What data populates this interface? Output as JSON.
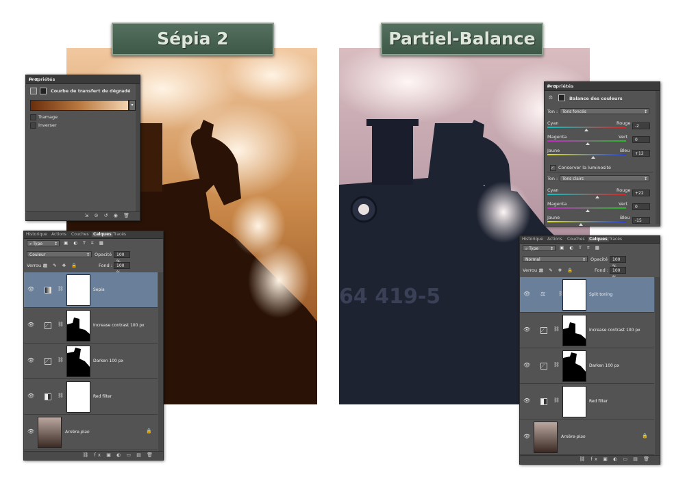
{
  "titles": {
    "left": "Sépia 2",
    "right": "Partiel-Balance"
  },
  "left_properties": {
    "title": "Propriétés",
    "heading": "Courbe de transfert de dégradé",
    "options": [
      "Tramage",
      "Inverser"
    ]
  },
  "left_layers": {
    "tabs": [
      "Historique",
      "Actions",
      "Couches",
      "Calques",
      "Tracés"
    ],
    "filter": "Type",
    "blend_mode": "Couleur",
    "opacity_label": "Opacité :",
    "opacity_value": "100 %",
    "lock_label": "Verrou :",
    "fill_label": "Fond :",
    "fill_value": "100 %",
    "layers": [
      "Sepia",
      "Increase contrast 100 px",
      "Darken 100 px",
      "Red filter",
      "Arrière-plan"
    ]
  },
  "right_properties": {
    "title": "Propriétés",
    "heading": "Balance des couleurs",
    "tone_label": "Ton :",
    "tone1": "Tons foncés",
    "tone2": "Tons clairs",
    "cyan": "Cyan",
    "rouge": "Rouge",
    "magenta": "Magenta",
    "vert": "Vert",
    "jaune": "Jaune",
    "bleu": "Bleu",
    "values1": [
      "-2",
      "0",
      "+12"
    ],
    "values2": [
      "+22",
      "0",
      "-15"
    ],
    "preserve": "Conserver la luminosité"
  },
  "right_layers": {
    "tabs": [
      "Historique",
      "Actions",
      "Couches",
      "Calques",
      "Tracés"
    ],
    "filter": "Type",
    "blend_mode": "Normal",
    "opacity_label": "Opacité :",
    "opacity_value": "100 %",
    "lock_label": "Verrou :",
    "fill_label": "Fond :",
    "fill_value": "100 %",
    "layers": [
      "Split toning",
      "Increase contrast 100 px",
      "Darken 100 px",
      "Red filter",
      "Arrière-plan"
    ]
  },
  "photo_text": "64 419-5",
  "colors": {
    "sepia": "#a8581d",
    "balance_sky": "#cdb0b4",
    "selected_layer": "#6a7f99"
  }
}
